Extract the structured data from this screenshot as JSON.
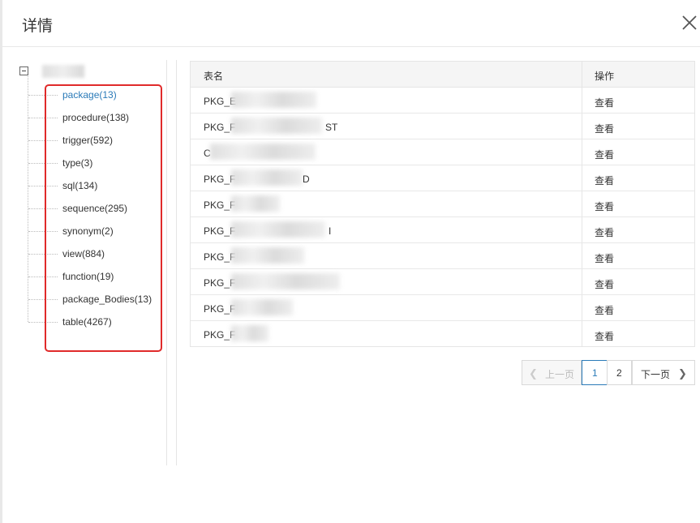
{
  "dialog": {
    "title": "详情"
  },
  "tree": {
    "items": [
      {
        "label": "package(13)",
        "selected": true
      },
      {
        "label": "procedure(138)"
      },
      {
        "label": "trigger(592)"
      },
      {
        "label": "type(3)"
      },
      {
        "label": "sql(134)"
      },
      {
        "label": "sequence(295)"
      },
      {
        "label": "synonym(2)"
      },
      {
        "label": "view(884)"
      },
      {
        "label": "function(19)"
      },
      {
        "label": "package_Bodies(13)"
      },
      {
        "label": "table(4267)"
      }
    ]
  },
  "table": {
    "headers": {
      "name": "表名",
      "action": "操作"
    },
    "rows": [
      {
        "name": "PKG_E",
        "tail": "",
        "action": "查看"
      },
      {
        "name": "PKG_F",
        "tail": "ST",
        "action": "查看"
      },
      {
        "name": "C",
        "tail": "",
        "action": "查看"
      },
      {
        "name": "PKG_F",
        "tail": "D",
        "action": "查看"
      },
      {
        "name": "PKG_F",
        "tail": "",
        "action": "查看"
      },
      {
        "name": "PKG_F",
        "tail": "I",
        "action": "查看"
      },
      {
        "name": "PKG_F",
        "tail": "",
        "action": "查看"
      },
      {
        "name": "PKG_F",
        "tail": "",
        "action": "查看"
      },
      {
        "name": "PKG_F",
        "tail": "",
        "action": "查看"
      },
      {
        "name": "PKG_F",
        "tail": "",
        "action": "查看"
      }
    ]
  },
  "pagination": {
    "prev": "上一页",
    "pages": [
      "1",
      "2"
    ],
    "current": "1",
    "next": "下一页"
  },
  "colors": {
    "accent": "#2a7ab8",
    "highlight": "#e02a2a"
  }
}
